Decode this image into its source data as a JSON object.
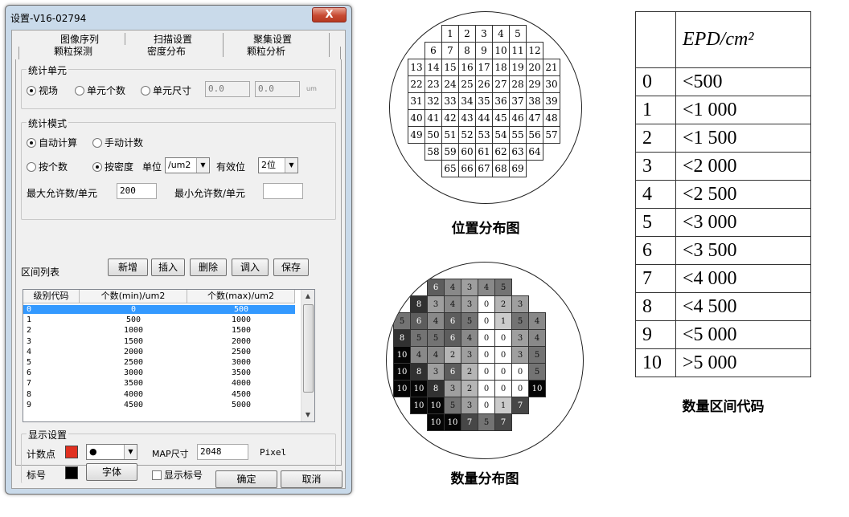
{
  "window": {
    "title": "设置-V16-02794",
    "close": "X"
  },
  "tabs": {
    "row1": [
      "图像序列",
      "扫描设置",
      "聚集设置"
    ],
    "row2": [
      "颗粒探测",
      "密度分布",
      "颗粒分析"
    ]
  },
  "unit_group": {
    "label": "统计单元",
    "opt1": "视场",
    "opt2": "单元个数",
    "opt3": "单元尺寸",
    "v1": "0.0",
    "v2": "0.0",
    "unit": "um"
  },
  "mode_group": {
    "label": "统计模式",
    "auto": "自动计算",
    "manual": "手动计数",
    "bycount": "按个数",
    "bydensity": "按密度",
    "unit_label": "单位",
    "unit_value": "/um2",
    "digits_label": "有效位",
    "digits_value": "2位",
    "max_label": "最大允许数/单元",
    "max_value": "200",
    "min_label": "最小允许数/单元",
    "min_value": ""
  },
  "interval": {
    "label": "区间列表",
    "buttons": [
      "新增",
      "插入",
      "删除",
      "调入",
      "保存"
    ],
    "headers": [
      "级别代码",
      "个数(min)/um2",
      "个数(max)/um2"
    ],
    "rows": [
      [
        "0",
        "0",
        "500"
      ],
      [
        "1",
        "500",
        "1000"
      ],
      [
        "2",
        "1000",
        "1500"
      ],
      [
        "3",
        "1500",
        "2000"
      ],
      [
        "4",
        "2000",
        "2500"
      ],
      [
        "5",
        "2500",
        "3000"
      ],
      [
        "6",
        "3000",
        "3500"
      ],
      [
        "7",
        "3500",
        "4000"
      ],
      [
        "8",
        "4000",
        "4500"
      ],
      [
        "9",
        "4500",
        "5000"
      ]
    ]
  },
  "display": {
    "label": "显示设置",
    "point_label": "计数点",
    "map_label": "MAP尺寸",
    "map_value": "2048",
    "map_unit": "Pixel",
    "mark_label": "标号",
    "font_btn": "字体",
    "show_mark": "显示标号",
    "point_color": "#e03020"
  },
  "footer": {
    "ok": "确定",
    "cancel": "取消"
  },
  "position_map": {
    "caption": "位置分布图",
    "rows": [
      [
        "1",
        "2",
        "3",
        "4",
        "5"
      ],
      [
        "6",
        "7",
        "8",
        "9",
        "10",
        "11",
        "12"
      ],
      [
        "13",
        "14",
        "15",
        "16",
        "17",
        "18",
        "19",
        "20",
        "21"
      ],
      [
        "22",
        "23",
        "24",
        "25",
        "26",
        "27",
        "28",
        "29",
        "30"
      ],
      [
        "31",
        "32",
        "33",
        "34",
        "35",
        "36",
        "37",
        "38",
        "39"
      ],
      [
        "40",
        "41",
        "42",
        "43",
        "44",
        "45",
        "46",
        "47",
        "48"
      ],
      [
        "49",
        "50",
        "51",
        "52",
        "53",
        "54",
        "55",
        "56",
        "57"
      ],
      [
        "58",
        "59",
        "60",
        "61",
        "62",
        "63",
        "64"
      ],
      [
        "65",
        "66",
        "67",
        "68",
        "69"
      ]
    ]
  },
  "count_map": {
    "caption": "数量分布图",
    "rows": [
      [
        "6",
        "4",
        "3",
        "4",
        "5"
      ],
      [
        "8",
        "3",
        "4",
        "3",
        "0",
        "2",
        "3"
      ],
      [
        "5",
        "6",
        "4",
        "6",
        "5",
        "0",
        "1",
        "5",
        "4"
      ],
      [
        "8",
        "5",
        "5",
        "6",
        "4",
        "0",
        "0",
        "3",
        "4"
      ],
      [
        "10",
        "4",
        "4",
        "2",
        "3",
        "0",
        "0",
        "3",
        "5"
      ],
      [
        "10",
        "8",
        "3",
        "6",
        "2",
        "0",
        "0",
        "0",
        "5"
      ],
      [
        "10",
        "10",
        "8",
        "3",
        "2",
        "0",
        "0",
        "0",
        "10"
      ],
      [
        "10",
        "10",
        "5",
        "3",
        "0",
        "1",
        "7"
      ],
      [
        "10",
        "10",
        "7",
        "5",
        "7"
      ]
    ]
  },
  "epd_table": {
    "caption": "数量区间代码",
    "header_unit": "EPD/cm²",
    "rows": [
      [
        "0",
        "<500"
      ],
      [
        "1",
        "<1 000"
      ],
      [
        "2",
        "<1 500"
      ],
      [
        "3",
        "<2 000"
      ],
      [
        "4",
        "<2 500"
      ],
      [
        "5",
        "<3 000"
      ],
      [
        "6",
        "<3 500"
      ],
      [
        "7",
        "<4 000"
      ],
      [
        "8",
        "<4 500"
      ],
      [
        "9",
        "<5 000"
      ],
      [
        "10",
        ">5 000"
      ]
    ]
  }
}
